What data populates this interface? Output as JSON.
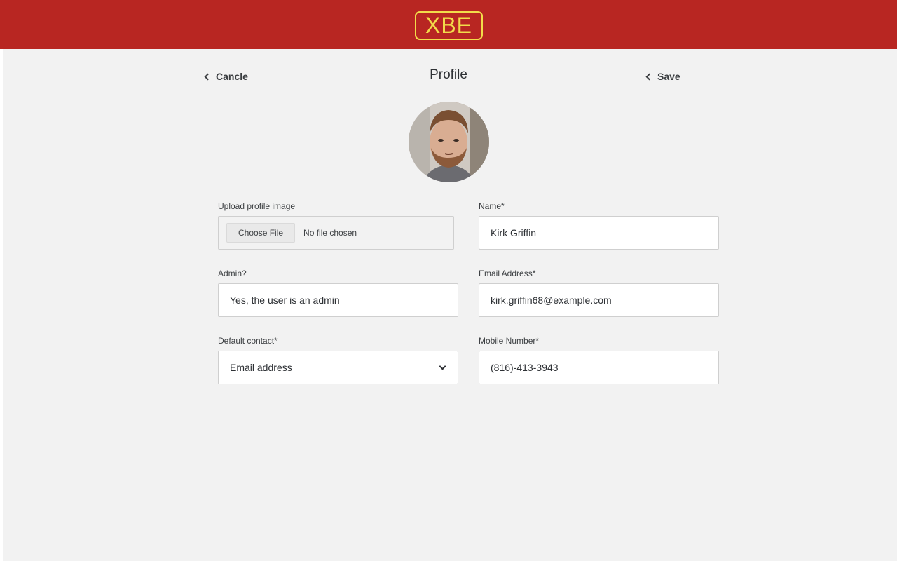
{
  "header": {
    "logo_text": "XBE",
    "brand_color": "#b82622",
    "logo_color": "#f2dc4a"
  },
  "topbar": {
    "cancel_label": "Cancle",
    "title": "Profile",
    "save_label": "Save"
  },
  "form": {
    "upload": {
      "label": "Upload profile image",
      "button_label": "Choose File",
      "status": "No file chosen"
    },
    "name": {
      "label": "Name*",
      "value": "Kirk Griffin"
    },
    "admin": {
      "label": "Admin?",
      "value": "Yes, the user is an admin"
    },
    "email": {
      "label": "Email Address*",
      "value": "kirk.griffin68@example.com"
    },
    "default_contact": {
      "label": "Default contact*",
      "value": "Email address"
    },
    "mobile": {
      "label": "Mobile Number*",
      "value": "(816)-413-3943"
    }
  },
  "icons": {
    "back": "chevron-left-icon",
    "select": "chevron-down-icon"
  }
}
